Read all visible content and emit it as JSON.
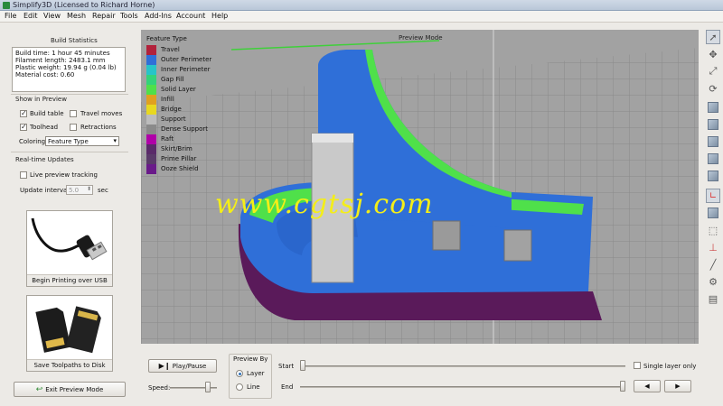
{
  "window": {
    "title": "Simplify3D (Licensed to Richard Horne)"
  },
  "menu": [
    "File",
    "Edit",
    "View",
    "Mesh",
    "Repair",
    "Tools",
    "Add-Ins",
    "Account",
    "Help"
  ],
  "build_statistics": {
    "title": "Build Statistics",
    "lines": [
      "Build time: 1 hour 45 minutes",
      "Filament length: 2483.1 mm",
      "Plastic weight: 19.94 g (0.04 lb)",
      "Material cost: 0.60"
    ]
  },
  "show_in_preview": {
    "title": "Show in Preview",
    "build_table": {
      "label": "Build table",
      "checked": true
    },
    "travel_moves": {
      "label": "Travel moves",
      "checked": false
    },
    "toolhead": {
      "label": "Toolhead",
      "checked": true
    },
    "retractions": {
      "label": "Retractions",
      "checked": false
    },
    "coloring_label": "Coloring",
    "coloring_value": "Feature Type"
  },
  "realtime": {
    "title": "Real-time Updates",
    "live_tracking": {
      "label": "Live preview tracking",
      "checked": false
    },
    "interval_label": "Update interval",
    "interval_value": "5.0",
    "interval_unit": "sec"
  },
  "actions": {
    "print_usb": "Begin Printing over USB",
    "save_disk": "Save Toolpaths to Disk",
    "exit_preview": "Exit Preview Mode"
  },
  "viewport": {
    "mode_label": "Preview Mode",
    "legend_title": "Feature Type",
    "legend": [
      {
        "name": "Travel",
        "color": "#b2213b"
      },
      {
        "name": "Outer Perimeter",
        "color": "#2f6fd8"
      },
      {
        "name": "Inner Perimeter",
        "color": "#27c4c8"
      },
      {
        "name": "Gap Fill",
        "color": "#33d37a"
      },
      {
        "name": "Solid Layer",
        "color": "#4fe04a"
      },
      {
        "name": "Infill",
        "color": "#e0a020"
      },
      {
        "name": "Bridge",
        "color": "#e8d820"
      },
      {
        "name": "Support",
        "color": "#bcbcbc"
      },
      {
        "name": "Dense Support",
        "color": "#8a8a8a"
      },
      {
        "name": "Raft",
        "color": "#b000a8"
      },
      {
        "name": "Skirt/Brim",
        "color": "#5a2a6a"
      },
      {
        "name": "Prime Pillar",
        "color": "#5a3a6a"
      },
      {
        "name": "Ooze Shield",
        "color": "#6a1a8a"
      }
    ],
    "watermark": "www.cgtsj.com"
  },
  "toolbar_icons": [
    "select-arrow-icon",
    "move-icon",
    "view-fit-icon",
    "rotate-icon",
    "view-cube-front-icon",
    "view-cube-top-icon",
    "view-cube-side-icon",
    "view-cube-iso-icon",
    "view-cube-bottom-icon",
    "axes-icon",
    "cube-solid-icon",
    "cube-wire-icon",
    "tool-nozzle-icon",
    "line-icon",
    "gear-icon",
    "layers-icon"
  ],
  "controls": {
    "play_pause": "Play/Pause",
    "speed_label": "Speed:",
    "speed_value": 0.85,
    "preview_by_title": "Preview By",
    "layer": {
      "label": "Layer",
      "selected": true
    },
    "line": {
      "label": "Line",
      "selected": false
    },
    "start_label": "Start",
    "end_label": "End",
    "start_value": 0.0,
    "end_value": 1.0,
    "single_layer": {
      "label": "Single layer only",
      "checked": false
    },
    "prev_icon": "◀",
    "next_icon": "▶"
  }
}
